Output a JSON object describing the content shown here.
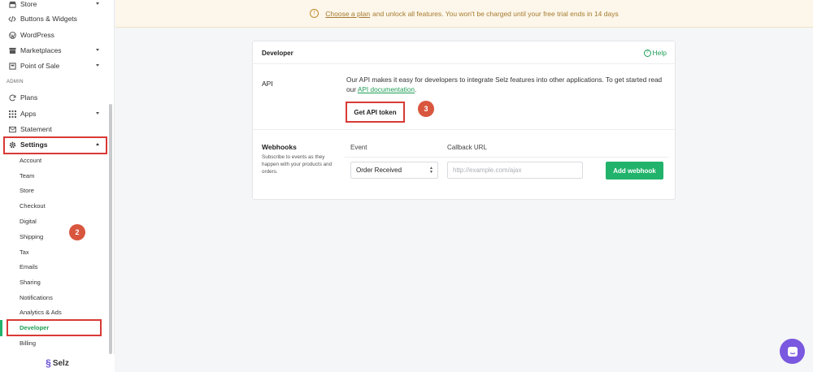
{
  "sidebar": {
    "items": [
      {
        "label": "Store",
        "icon": "store-icon",
        "caret": true
      },
      {
        "label": "Buttons & Widgets",
        "icon": "code-icon",
        "caret": false
      },
      {
        "label": "WordPress",
        "icon": "wordpress-icon",
        "caret": false
      },
      {
        "label": "Marketplaces",
        "icon": "shop-icon",
        "caret": true
      },
      {
        "label": "Point of Sale",
        "icon": "pos-icon",
        "caret": true
      }
    ],
    "admin_label": "ADMIN",
    "admin_items": [
      {
        "label": "Plans",
        "icon": "refresh-icon",
        "caret": false
      },
      {
        "label": "Apps",
        "icon": "grid-icon",
        "caret": true
      },
      {
        "label": "Statement",
        "icon": "statement-icon",
        "caret": false
      },
      {
        "label": "Settings",
        "icon": "gear-icon",
        "caret": true
      }
    ],
    "settings_sub": [
      "Account",
      "Team",
      "Store",
      "Checkout",
      "Digital",
      "Shipping",
      "Tax",
      "Emails",
      "Sharing",
      "Notifications",
      "Analytics & Ads",
      "Developer",
      "Billing"
    ],
    "active_sub": "Developer",
    "brand": "Selz"
  },
  "banner": {
    "link": "Choose a plan",
    "text": "and unlock all features. You won't be charged until your free trial ends in 14 days"
  },
  "card": {
    "title": "Developer",
    "help": "Help",
    "api_label": "API",
    "api_desc": "Our API makes it easy for developers to integrate Selz features into other applications. To get started read our",
    "api_link": "API documentation",
    "api_link_suffix": ".",
    "token_button": "Get API token",
    "webhooks_title": "Webhooks",
    "webhooks_desc": "Subscribe to events as they happen with your products and orders.",
    "event_header": "Event",
    "callback_header": "Callback URL",
    "event_value": "Order Received",
    "callback_placeholder": "http://example.com/ajax",
    "add_button": "Add webhook"
  },
  "annotations": {
    "step2": "2",
    "step3": "3"
  },
  "colors": {
    "accent": "#21b36b",
    "highlight": "#d83a35",
    "badge": "#d9563e",
    "chat": "#7a58df"
  }
}
